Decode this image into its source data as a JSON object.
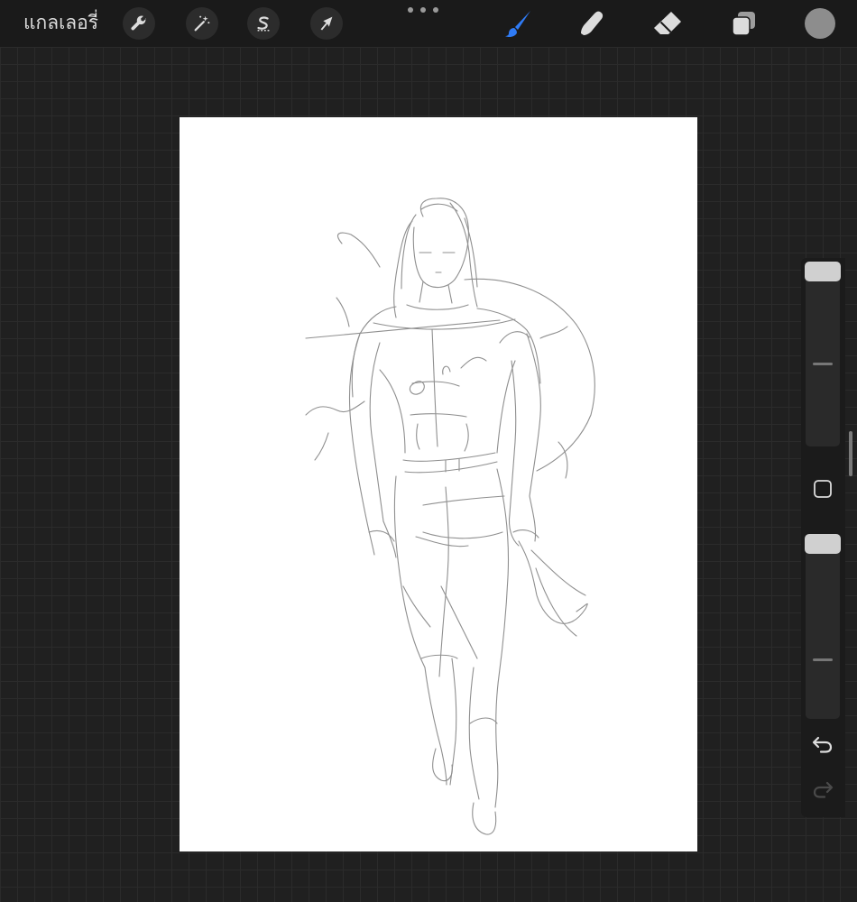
{
  "topbar": {
    "gallery_label": "แกลเลอรี่",
    "left_tools": [
      {
        "name": "actions",
        "icon": "wrench-icon"
      },
      {
        "name": "adjustments",
        "icon": "magic-wand-icon"
      },
      {
        "name": "selection",
        "icon": "selection-s-icon"
      },
      {
        "name": "transform",
        "icon": "arrow-cursor-icon"
      }
    ],
    "right_tools": [
      {
        "name": "brush",
        "icon": "brush-icon",
        "active": true
      },
      {
        "name": "smudge",
        "icon": "smudge-finger-icon",
        "active": false
      },
      {
        "name": "eraser",
        "icon": "eraser-icon",
        "active": false
      },
      {
        "name": "layers",
        "icon": "layers-icon",
        "active": false
      }
    ],
    "more_icon": "more-dots-icon",
    "current_color": "#8d8d8d"
  },
  "sidebar": {
    "brush_size_slider": {
      "icon": "slider-thumb",
      "level": 1.0
    },
    "modify_button_icon": "square-icon",
    "opacity_slider": {
      "icon": "slider-thumb",
      "level": 1.0
    },
    "undo_icon": "undo-arrow-icon",
    "redo_icon": "redo-arrow-icon",
    "redo_enabled": false
  },
  "canvas": {
    "content": "pencil-sketch-figure",
    "background": "#ffffff"
  },
  "colors": {
    "active_tool": "#2f7bf5",
    "toolbar_bg": "#1a1a1a",
    "workspace_bg": "#202020",
    "icon_fg": "#dcdcdc"
  }
}
